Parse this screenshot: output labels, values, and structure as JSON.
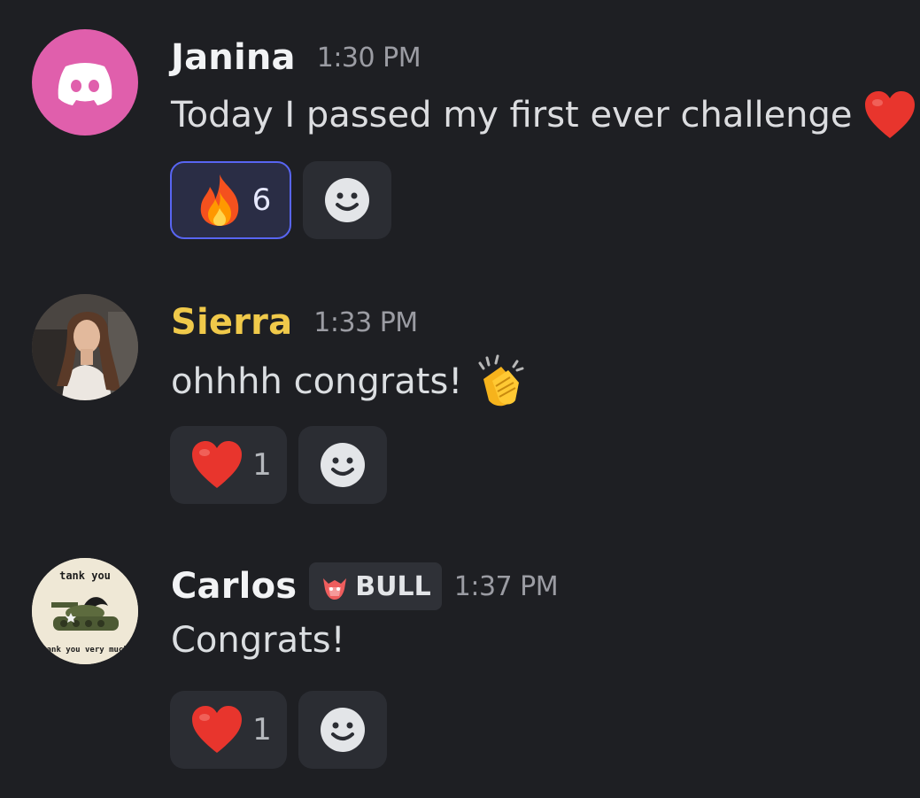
{
  "messages": [
    {
      "author": "Janina",
      "author_color": "#f2f3f5",
      "time": "1:30 PM",
      "text": "Today I passed my first ever challenge",
      "avatar": "discord-logo-avatar",
      "reactions": [
        {
          "emoji": "fire",
          "count": "6",
          "active": true
        }
      ]
    },
    {
      "author": "Sierra",
      "author_color": "#f0c94a",
      "time": "1:33 PM",
      "text": "ohhhh congrats!",
      "avatar": "woman-portrait-avatar",
      "reactions": [
        {
          "emoji": "red-heart",
          "count": "1",
          "active": false
        }
      ]
    },
    {
      "author": "Carlos",
      "author_color": "#f2f3f5",
      "time": "1:37 PM",
      "text": "Congrats!",
      "avatar": "tank-cartoon-avatar",
      "avatar_text_top": "tank you",
      "avatar_text_bottom": "tank you very much",
      "role": "BULL",
      "reactions": [
        {
          "emoji": "red-heart",
          "count": "1",
          "active": false
        }
      ]
    }
  ],
  "colors": {
    "background": "#1e1f23",
    "reaction_bg": "#2b2d33",
    "reaction_active_border": "#5865f2",
    "discord_avatar_bg": "#e05fac"
  }
}
